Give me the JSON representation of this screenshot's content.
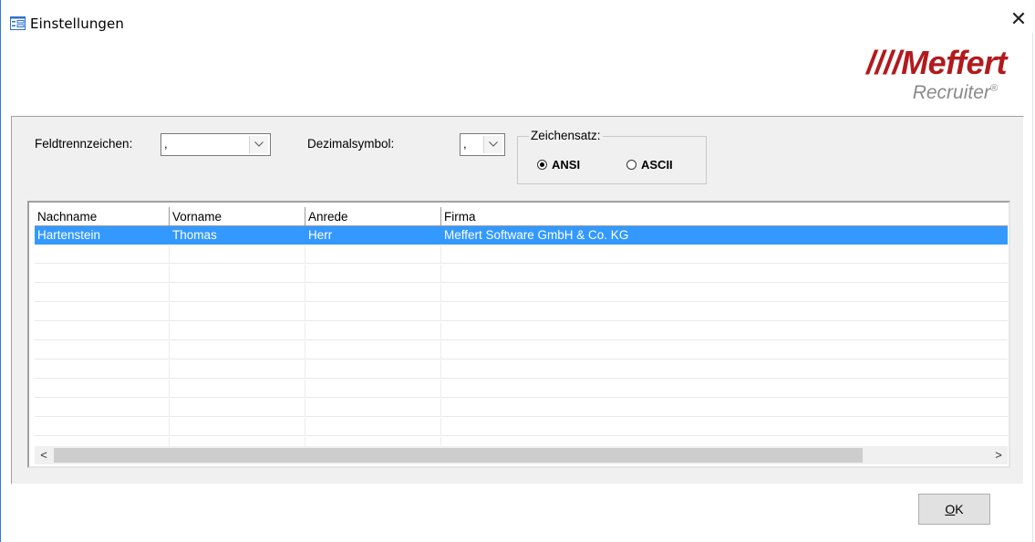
{
  "window": {
    "title": "Einstellungen",
    "close_glyph": "✕"
  },
  "logo": {
    "brand": "////Meffert",
    "product": "Recruiter",
    "reg": "®"
  },
  "form": {
    "field_sep_label": "Feldtrennzeichen:",
    "field_sep_value": ",",
    "decimal_label": "Dezimalsymbol:",
    "decimal_value": ",",
    "charset_label": "Zeichensatz:",
    "charset_options": [
      {
        "label": "ANSI",
        "selected": true
      },
      {
        "label": "ASCII",
        "selected": false
      }
    ]
  },
  "table": {
    "columns": [
      "Nachname",
      "Vorname",
      "Anrede",
      "Firma"
    ],
    "rows": [
      [
        "Hartenstein",
        "Thomas",
        "Herr",
        "Meffert Software GmbH & Co. KG"
      ]
    ],
    "empty_rows": 11,
    "scroll_left": "<",
    "scroll_right": ">"
  },
  "buttons": {
    "ok_label": "OK",
    "ok_accel": "O",
    "ok_rest": "K"
  },
  "colors": {
    "selection": "#3399ff",
    "brand_red": "#b21a1e"
  },
  "icons": {
    "app": "form-icon",
    "close": "close-icon",
    "dropdown": "chevron-down-icon"
  }
}
